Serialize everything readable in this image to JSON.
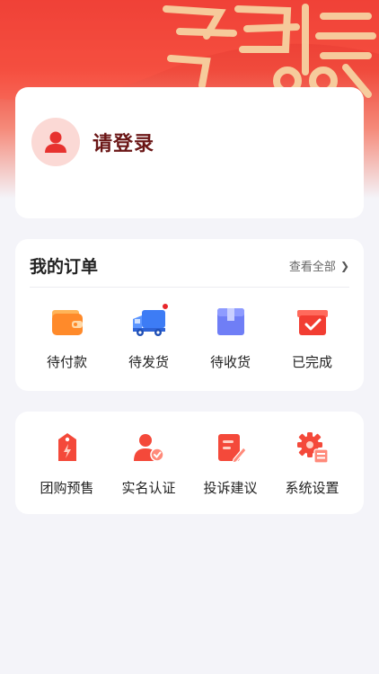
{
  "hero": {
    "banner_text": "飞博"
  },
  "login": {
    "prompt": "请登录"
  },
  "orders": {
    "title": "我的订单",
    "view_all": "查看全部",
    "items": [
      {
        "label": "待付款",
        "icon": "wallet-icon",
        "badge": false
      },
      {
        "label": "待发货",
        "icon": "delivery-truck-icon",
        "badge": true
      },
      {
        "label": "待收货",
        "icon": "package-box-icon",
        "badge": false
      },
      {
        "label": "已完成",
        "icon": "completed-box-icon",
        "badge": false
      }
    ]
  },
  "tools": {
    "items": [
      {
        "label": "团购预售",
        "icon": "price-tag-icon"
      },
      {
        "label": "实名认证",
        "icon": "verified-user-icon"
      },
      {
        "label": "投诉建议",
        "icon": "feedback-edit-icon"
      },
      {
        "label": "系统设置",
        "icon": "settings-gear-icon"
      }
    ]
  },
  "colors": {
    "brand_red": "#e8352f",
    "page_bg": "#f4f4f9",
    "login_text": "#6b1616",
    "badge": "#e8262a"
  }
}
